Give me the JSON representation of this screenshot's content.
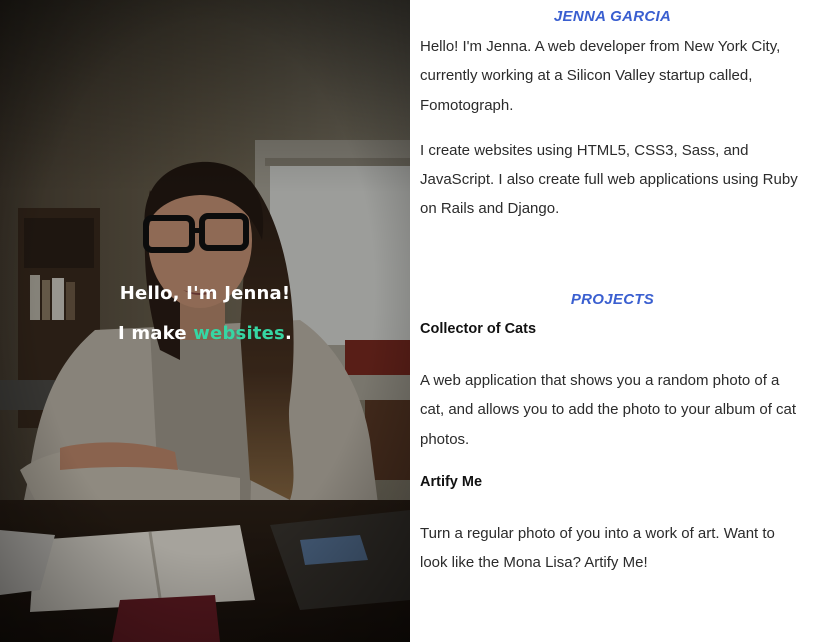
{
  "hero": {
    "greeting": "Hello, I'm Jenna!",
    "tagline_prefix": "I make ",
    "tagline_highlight": "websites",
    "tagline_suffix": ".",
    "accent_color": "#36d6a3"
  },
  "about": {
    "title": "JENNA GARCIA",
    "paragraphs": [
      "Hello! I'm Jenna. A web developer from New York City, currently working at a Silicon Valley startup called, Fomotograph.",
      "I create websites using HTML5, CSS3, Sass, and JavaScript. I also create full web applications using Ruby on Rails and Django."
    ]
  },
  "projects": {
    "title": "PROJECTS",
    "items": [
      {
        "name": "Collector of Cats",
        "description": "A web application that shows you a random photo of a cat, and allows you to add the photo to your album of cat photos."
      },
      {
        "name": "Artify Me",
        "description": "Turn a regular photo of you into a work of art. Want to look like the Mona Lisa? Artify Me!"
      }
    ]
  },
  "colors": {
    "heading": "#3a5fd0",
    "text": "#2b2b2b"
  }
}
